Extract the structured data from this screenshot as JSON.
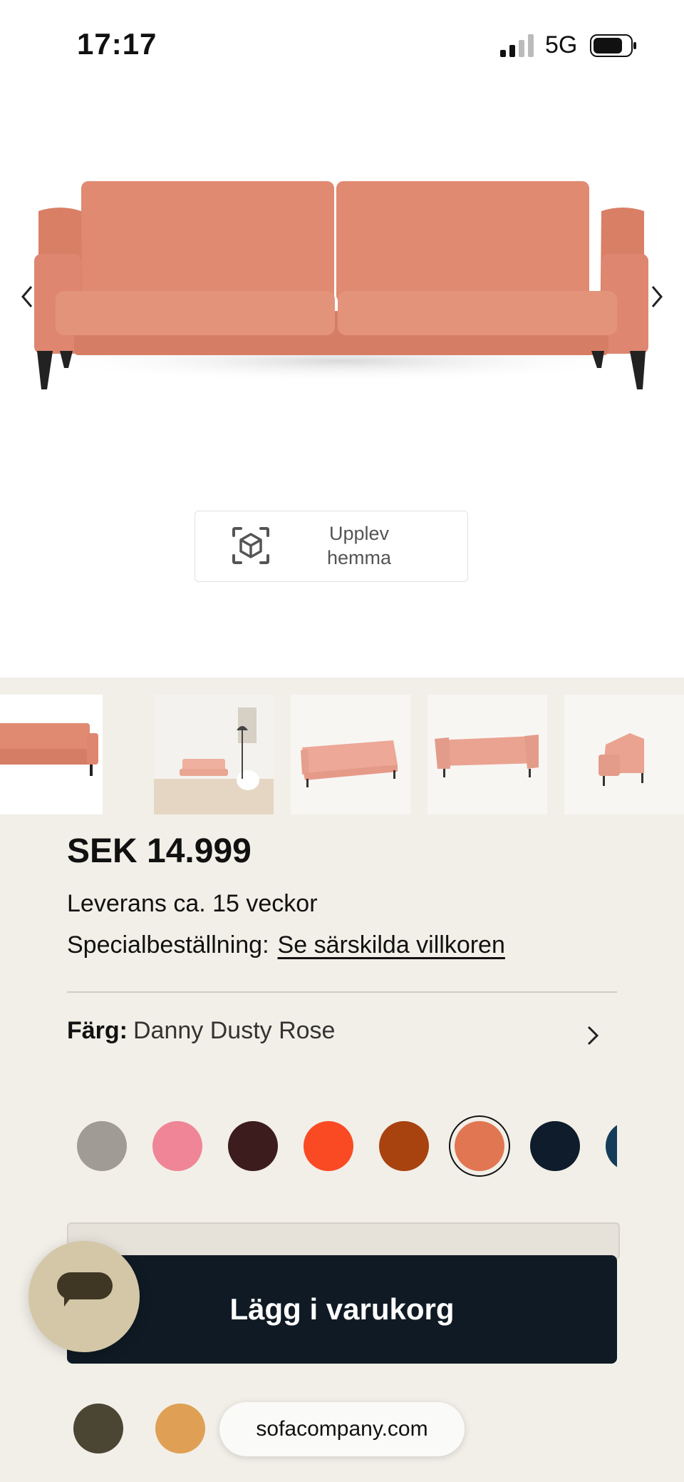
{
  "status_bar": {
    "time": "17:17",
    "network": "5G"
  },
  "gallery": {
    "prev_icon": "chevron-left-icon",
    "next_icon": "chevron-right-icon",
    "ar_label": "Upplev hemma",
    "ar_icon": "ar-cube-icon"
  },
  "product": {
    "price": "SEK 14.999",
    "delivery": "Leverans ca. 15 veckor",
    "special_label": "Specialbeställning:",
    "special_link": "Se särskilda villkoren"
  },
  "color": {
    "label": "Färg:",
    "value": "Danny Dusty Rose",
    "swatches": [
      "#a09c95",
      "#ef8596",
      "#3c1c1c",
      "#fa4a24",
      "#a8430f",
      "#e17652",
      "#0e1c2c",
      "#143c5a"
    ],
    "selected_index": 5
  },
  "cart": {
    "label": "Lägg i varukorg"
  },
  "leg_options": [
    "#4b4534",
    "#dfa055"
  ],
  "browser": {
    "url": "sofacompany.com"
  },
  "colors": {
    "sofa": "#e28c74",
    "panel_bg": "#f2efe8",
    "cart_bg": "#0f1a24",
    "chat_bg": "#d3c7a7"
  }
}
